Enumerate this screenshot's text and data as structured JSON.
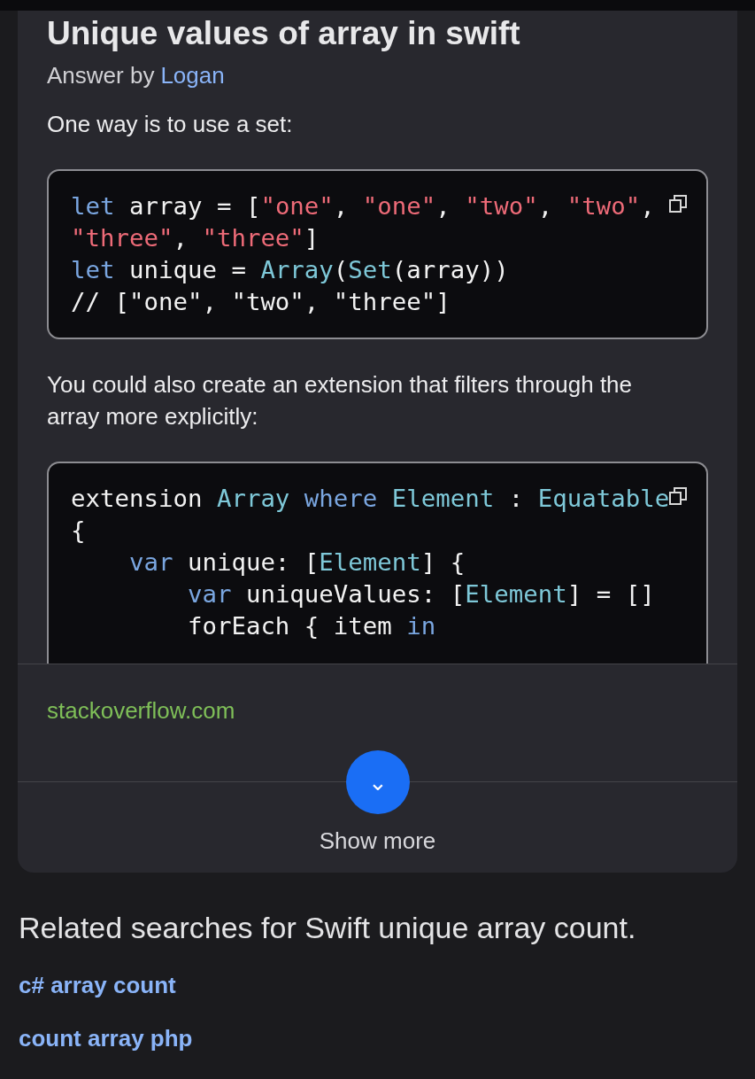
{
  "answer": {
    "title": "Unique values of array in swift",
    "byline": {
      "prefix": "Answer by",
      "author": "Logan"
    },
    "blocks": [
      {
        "kind": "text",
        "text": "One way is to use a set:"
      },
      {
        "kind": "code",
        "lines": [
          [
            {
              "t": "let",
              "kind": "keyword"
            },
            {
              "t": " array = [",
              "kind": "plain"
            },
            {
              "t": "\"one\"",
              "kind": "string"
            },
            {
              "t": ", ",
              "kind": "plain"
            },
            {
              "t": "\"one\"",
              "kind": "string"
            },
            {
              "t": ", ",
              "kind": "plain"
            },
            {
              "t": "\"two\"",
              "kind": "string"
            },
            {
              "t": ", ",
              "kind": "plain"
            },
            {
              "t": "\"two\"",
              "kind": "string"
            },
            {
              "t": ",",
              "kind": "plain"
            }
          ],
          [
            {
              "t": "\"three\"",
              "kind": "string"
            },
            {
              "t": ", ",
              "kind": "plain"
            },
            {
              "t": "\"three\"",
              "kind": "string"
            },
            {
              "t": "]",
              "kind": "plain"
            }
          ],
          [
            {
              "t": "let",
              "kind": "keyword"
            },
            {
              "t": " unique = ",
              "kind": "plain"
            },
            {
              "t": "Array",
              "kind": "type"
            },
            {
              "t": "(",
              "kind": "plain"
            },
            {
              "t": "Set",
              "kind": "type"
            },
            {
              "t": "(array))",
              "kind": "plain"
            }
          ],
          [
            {
              "t": "// [\"one\", \"two\", \"three\"]",
              "kind": "plain"
            }
          ]
        ],
        "clipped": false
      },
      {
        "kind": "text",
        "text": "You could also create an extension that filters through the array more explicitly:"
      },
      {
        "kind": "code",
        "lines": [
          [
            {
              "t": "extension",
              "kind": "plain"
            },
            {
              "t": " Array",
              "kind": "type"
            },
            {
              "t": " where",
              "kind": "keyword"
            },
            {
              "t": " Element",
              "kind": "type"
            },
            {
              "t": " : ",
              "kind": "plain"
            },
            {
              "t": "Equatable",
              "kind": "type"
            }
          ],
          [
            {
              "t": "{",
              "kind": "plain"
            }
          ],
          [
            {
              "t": "    var",
              "kind": "keyword"
            },
            {
              "t": " unique: [",
              "kind": "plain"
            },
            {
              "t": "Element",
              "kind": "type"
            },
            {
              "t": "] {",
              "kind": "plain"
            }
          ],
          [
            {
              "t": "        var",
              "kind": "keyword"
            },
            {
              "t": " uniqueValues: [",
              "kind": "plain"
            },
            {
              "t": "Element",
              "kind": "type"
            },
            {
              "t": "] = []",
              "kind": "plain"
            }
          ],
          [
            {
              "t": "        forEach { item ",
              "kind": "plain"
            },
            {
              "t": "in",
              "kind": "keyword"
            }
          ]
        ],
        "clipped": true
      }
    ],
    "source": "stackoverflow.com",
    "show_more": {
      "icon": "⌄",
      "label": "Show more"
    }
  },
  "related": {
    "heading": "Related searches for Swift unique array count.",
    "links": [
      "c# array count",
      "count array php"
    ]
  }
}
